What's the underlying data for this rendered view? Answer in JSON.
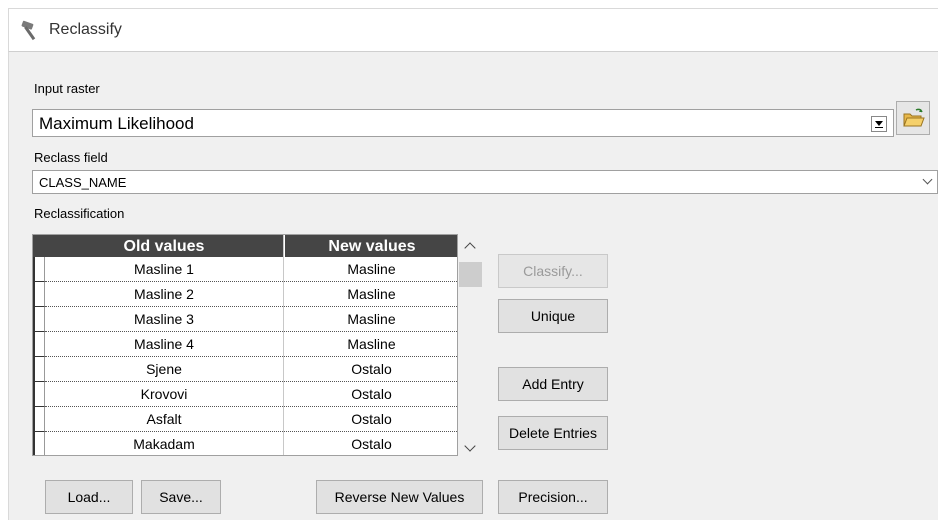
{
  "window": {
    "title": "Reclassify",
    "icon": "hammer-icon"
  },
  "input_raster": {
    "label": "Input raster",
    "value": "Maximum Likelihood",
    "browse_icon": "open-folder-icon"
  },
  "reclass_field": {
    "label": "Reclass field",
    "value": "CLASS_NAME"
  },
  "reclassification": {
    "label": "Reclassification",
    "columns": [
      "Old values",
      "New values"
    ],
    "rows": [
      {
        "old": "Masline 1",
        "new": "Masline"
      },
      {
        "old": "Masline 2",
        "new": "Masline"
      },
      {
        "old": "Masline 3",
        "new": "Masline"
      },
      {
        "old": "Masline 4",
        "new": "Masline"
      },
      {
        "old": "Sjene",
        "new": "Ostalo"
      },
      {
        "old": "Krovovi",
        "new": "Ostalo"
      },
      {
        "old": "Asfalt",
        "new": "Ostalo"
      },
      {
        "old": "Makadam",
        "new": "Ostalo"
      }
    ]
  },
  "buttons": {
    "classify": "Classify...",
    "unique": "Unique",
    "add_entry": "Add Entry",
    "delete_entries": "Delete Entries",
    "load": "Load...",
    "save": "Save...",
    "reverse": "Reverse New Values",
    "precision": "Precision..."
  }
}
